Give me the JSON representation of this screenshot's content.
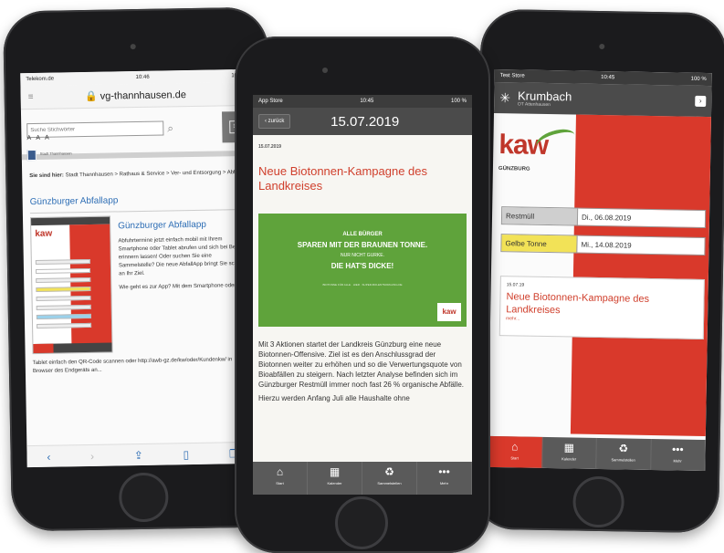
{
  "phone1": {
    "status": {
      "left": "Telekom.de",
      "time": "10:46",
      "right": "100 %"
    },
    "url": "vg-thannhausen.de",
    "search_placeholder": "Suche Stichwörter",
    "font_sizes": "A A A",
    "site_label": "Stadt Thannhausen",
    "breadcrumb_lead": "Sie sind hier:",
    "breadcrumb": "Stadt Thannhausen > Rathaus & Service > Ver- und Entsorgung > Abfall",
    "app_title": "Günzburger Abfallapp",
    "app_heading": "Günzburger Abfallapp",
    "app_text": "Abfuhrtermine jetzt einfach mobil mit Ihrem Smartphone oder Tablet abrufen und sich bei Bedarf erinnern lassen! Oder suchen Sie eine Sammelstelle? Die neue AbfallApp bringt Sie schnell an Ihr Ziel.",
    "app_more": "Wie geht es zur App? Mit dem Smartphone oder",
    "para": "Tablet einfach den QR-Code scannen oder http://awb-gz.de/kw/oder/Kundenkw/ in Browser des Endgeräts an..."
  },
  "phone2": {
    "status": {
      "left": "App Store",
      "time": "10:45",
      "right": "100 %"
    },
    "back_label": "zurück",
    "header_date": "15.07.2019",
    "article_date": "15.07.2019",
    "article_title": "Neue Biotonnen-Kampagne des Landkreises",
    "ad": {
      "line1": "ALLE BÜRGER",
      "line2": "SPAREN MIT DER BRAUNEN TONNE.",
      "line3": "NUR NICHT GURKE.",
      "line4": "DIE HAT'S DICKE!",
      "fine": "BIOTONNE FÜR ALLE · HIER · SUPER-BIO-ENTSORGUNG.DE",
      "logo": "kaw"
    },
    "body": "Mit 3 Aktionen startet der Landkreis Günzburg eine neue Biotonnen-Offensive. Ziel ist es den Anschlussgrad der Biotonnen weiter zu erhöhen und so die Verwertungsquote von Bioabfällen zu steigern. Nach letzter Analyse befinden sich im Günzburger Restmüll immer noch fast 26 % organische Abfälle.",
    "body2": "Hierzu werden Anfang Juli alle Haushalte ohne",
    "tabs": [
      {
        "icon": "home-icon",
        "glyph": "⌂",
        "label": "Start"
      },
      {
        "icon": "calendar-icon",
        "glyph": "▦",
        "label": "Kalender"
      },
      {
        "icon": "recycle-icon",
        "glyph": "♻",
        "label": "Sammelstellen"
      },
      {
        "icon": "more-icon",
        "glyph": "•••",
        "label": "Mehr"
      }
    ]
  },
  "phone3": {
    "status": {
      "left": "Test Store",
      "time": "10:45",
      "right": "100 %"
    },
    "city": "Krumbach",
    "city_sub": "OT Attenhausen",
    "logo_text": "kaw",
    "logo_sub": "GÜNZBURG",
    "rows": [
      {
        "label": "Restmüll",
        "value": "Di., 06.08.2019",
        "color": "#cfcfcf"
      },
      {
        "label": "Gelbe Tonne",
        "value": "Mi., 14.08.2019",
        "color": "#f2e257"
      }
    ],
    "news": {
      "date": "15.07.19",
      "title": "Neue Biotonnen-Kampagne des Landkreises",
      "more": "mehr..."
    },
    "tabs": [
      {
        "icon": "home-icon",
        "glyph": "⌂",
        "label": "Start"
      },
      {
        "icon": "calendar-icon",
        "glyph": "▦",
        "label": "Kalender"
      },
      {
        "icon": "recycle-icon",
        "glyph": "♻",
        "label": "Sammelstellen"
      },
      {
        "icon": "more-icon",
        "glyph": "•••",
        "label": "Mehr"
      }
    ]
  },
  "colors": {
    "accent_red": "#d9392b",
    "title_red": "#d0402d",
    "link_blue": "#2e6eb5",
    "ad_green": "#5fa33b",
    "bar_grey": "#4b4b4b"
  }
}
